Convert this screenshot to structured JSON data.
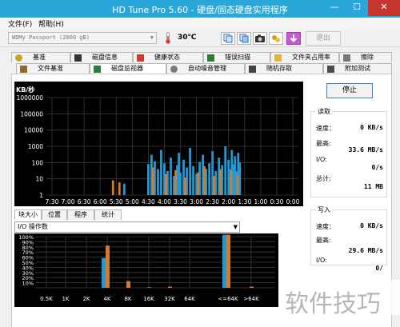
{
  "window": {
    "title": "HD Tune Pro 5.60 - 硬盘/固态硬盘实用程序",
    "minimize": "—",
    "maximize": "☐",
    "close": "✕"
  },
  "menu": {
    "file": "文件(F)",
    "help": "帮助(H)"
  },
  "toolbar": {
    "drive": "WDMy Passport (2000 gB)",
    "temperature": "30℃",
    "exit_label": "退出",
    "icons": [
      "copy-icon",
      "copy-screen-icon",
      "camera-icon",
      "tools-icon",
      "download-icon"
    ]
  },
  "tabs_row1": [
    {
      "label": "基准",
      "icon": "benchmark-icon",
      "color": "#c9a227"
    },
    {
      "label": "磁盘信息",
      "icon": "disk-info-icon",
      "color": "#333333"
    },
    {
      "label": "健康状态",
      "icon": "health-icon",
      "color": "#d33a2c"
    },
    {
      "label": "错误扫描",
      "icon": "error-scan-icon",
      "color": "#2e7d32"
    },
    {
      "label": "文件夹占用率",
      "icon": "folder-usage-icon",
      "color": "#e0b33b"
    },
    {
      "label": "擦除",
      "icon": "erase-icon",
      "color": "#555555"
    }
  ],
  "tabs_row2": [
    {
      "label": "文件基准",
      "icon": "file-benchmark-icon",
      "color": "#8c6c2b"
    },
    {
      "label": "磁盘监视器",
      "icon": "disk-monitor-icon",
      "color": "#2f7d3b",
      "active": true
    },
    {
      "label": "自动噪音管理",
      "icon": "noise-icon",
      "color": "#7a7a7a"
    },
    {
      "label": "随机存取",
      "icon": "random-access-icon",
      "color": "#444444"
    },
    {
      "label": "附加测试",
      "icon": "extra-test-icon",
      "color": "#4d4d4d"
    }
  ],
  "monitor": {
    "unit": "KB/秒",
    "stop_label": "停止"
  },
  "read_stats": {
    "title": "读取",
    "speed_label": "速度：",
    "speed_value": "0 KB/s",
    "max_label": "最高:",
    "max_value": "33.6 MB/s",
    "io_label": "I/O:",
    "io_value": "0/s",
    "total_label": "总计:",
    "total_value": "11 MB"
  },
  "write_stats": {
    "title": "写入",
    "speed_label": "速度：",
    "speed_value": "0 KB/s",
    "max_label": "最高:",
    "max_value": "29.6 MB/s",
    "io_label": "I/O:",
    "io_value": "0/"
  },
  "subtabs": [
    "块大小",
    "位置",
    "程序",
    "统计"
  ],
  "io_select": "I/O 操作数",
  "watermark": "软件技巧",
  "chart_data": [
    {
      "type": "bar",
      "title": "",
      "ylabel": "KB/秒",
      "yscale": "log",
      "yticks": [
        "1000000",
        "100000",
        "10000",
        "1000",
        "100",
        "10",
        "1"
      ],
      "xticks": [
        "7:30",
        "7:00",
        "6:30",
        "6:00",
        "5:30",
        "5:00",
        "4:30",
        "4:00",
        "3:30",
        "3:00",
        "2:30",
        "2:00",
        "1:30",
        "1:00",
        "0:30",
        "0:00"
      ],
      "grid": true,
      "series": [
        {
          "color": "#1e9bd7",
          "values": [
            [
              5.25,
              5
            ],
            [
              4.5,
              80
            ],
            [
              4.4,
              300
            ],
            [
              4.3,
              120
            ],
            [
              4.2,
              40
            ],
            [
              4.1,
              600
            ],
            [
              4.0,
              90
            ],
            [
              3.9,
              30
            ],
            [
              3.8,
              200
            ],
            [
              3.7,
              15
            ],
            [
              3.6,
              70
            ],
            [
              3.55,
              400
            ],
            [
              3.5,
              25
            ],
            [
              3.4,
              150
            ],
            [
              3.3,
              50
            ],
            [
              3.2,
              800
            ],
            [
              3.1,
              60
            ],
            [
              3.0,
              20
            ],
            [
              2.9,
              110
            ],
            [
              2.8,
              300
            ],
            [
              2.7,
              40
            ],
            [
              2.6,
              90
            ],
            [
              2.5,
              500
            ],
            [
              2.4,
              30
            ],
            [
              2.3,
              200
            ],
            [
              2.2,
              70
            ],
            [
              2.1,
              1000
            ],
            [
              2.0,
              150
            ],
            [
              1.95,
              40
            ],
            [
              1.9,
              600
            ],
            [
              1.85,
              80
            ],
            [
              1.8,
              250
            ],
            [
              1.75,
              30
            ],
            [
              1.7,
              400
            ],
            [
              1.65,
              100
            ]
          ]
        },
        {
          "color": "#d9792a",
          "values": [
            [
              5.6,
              8
            ],
            [
              5.4,
              6
            ],
            [
              4.35,
              50
            ],
            [
              3.95,
              20
            ],
            [
              3.65,
              35
            ],
            [
              3.35,
              12
            ],
            [
              2.95,
              25
            ],
            [
              2.75,
              60
            ],
            [
              2.45,
              15
            ],
            [
              2.25,
              40
            ],
            [
              1.92,
              30
            ],
            [
              1.72,
              18
            ]
          ]
        }
      ]
    },
    {
      "type": "bar",
      "title": "",
      "ylabel": "",
      "yticks": [
        "100%",
        "90%",
        "80%",
        "70%",
        "60%",
        "50%",
        "40%",
        "30%",
        "20%",
        "10%"
      ],
      "categories": [
        "0.5K",
        "1K",
        "2K",
        "4K",
        "8K",
        "16K",
        "32K",
        "64K",
        "<=64K",
        ">64K"
      ],
      "grid": true,
      "series": [
        {
          "name": "",
          "color": "#1e9bd7",
          "values": [
            0,
            0,
            0,
            53,
            0,
            0,
            0,
            0,
            100,
            0
          ]
        },
        {
          "name": "",
          "color": "#d9792a",
          "values": [
            0,
            0,
            0,
            75,
            12,
            1,
            2,
            0,
            100,
            2
          ]
        }
      ]
    }
  ]
}
